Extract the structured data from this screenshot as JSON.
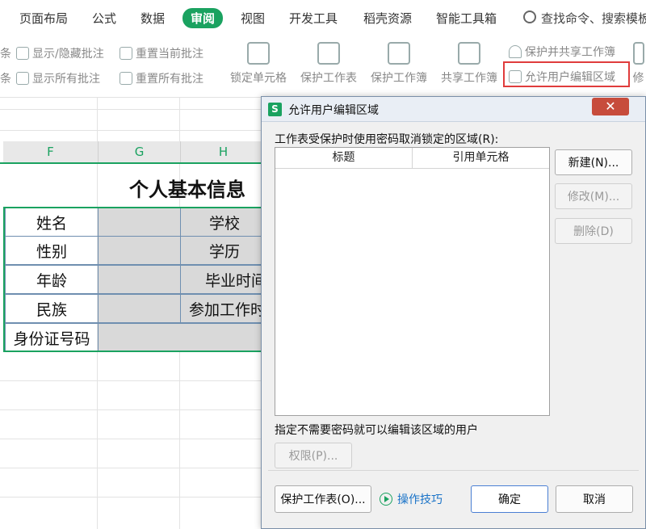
{
  "menubar": {
    "items": [
      {
        "label": "页面布局",
        "active": false
      },
      {
        "label": "公式",
        "active": false
      },
      {
        "label": "数据",
        "active": false
      },
      {
        "label": "审阅",
        "active": true
      },
      {
        "label": "视图",
        "active": false
      },
      {
        "label": "开发工具",
        "active": false
      },
      {
        "label": "稻壳资源",
        "active": false
      },
      {
        "label": "智能工具箱",
        "active": false
      }
    ],
    "search_label": "查找命令、搜索模板"
  },
  "ribbon": {
    "partial_left_top": "条",
    "partial_left_bottom": "条",
    "show_hide_comment": "显示/隐藏批注",
    "reset_current_comment": "重置当前批注",
    "show_all_comments": "显示所有批注",
    "reset_all_comments": "重置所有批注",
    "lock_cells": "锁定单元格",
    "protect_sheet": "保护工作表",
    "protect_workbook": "保护工作簿",
    "share_workbook": "共享工作簿",
    "protect_and_share": "保护并共享工作簿",
    "allow_edit_ranges": "允许用户编辑区域",
    "partial_right": "修"
  },
  "sheet": {
    "columns": [
      "F",
      "G",
      "H"
    ],
    "title": "个人基本信息",
    "rows": [
      {
        "label": "姓名",
        "right_label": "学校"
      },
      {
        "label": "性别",
        "right_label": "学历"
      },
      {
        "label": "年龄",
        "right_label": "毕业时间"
      },
      {
        "label": "民族",
        "right_label": "参加工作时"
      },
      {
        "label": "身份证号码",
        "right_label": ""
      }
    ]
  },
  "dialog": {
    "title": "允许用户编辑区域",
    "close_glyph": "✕",
    "ranges_label": "工作表受保护时使用密码取消锁定的区域(R):",
    "list_headers": [
      "标题",
      "引用单元格"
    ],
    "new_button": "新建(N)...",
    "modify_button": "修改(M)...",
    "delete_button": "删除(D)",
    "users_label": "指定不需要密码就可以编辑该区域的用户",
    "permissions_button": "权限(P)...",
    "protect_sheet_button": "保护工作表(O)...",
    "tips_link": "操作技巧",
    "ok_button": "确定",
    "cancel_button": "取消"
  },
  "colors": {
    "accent_green": "#1aa260",
    "highlight_red": "#e03c3c",
    "link_blue": "#1a73c8"
  }
}
